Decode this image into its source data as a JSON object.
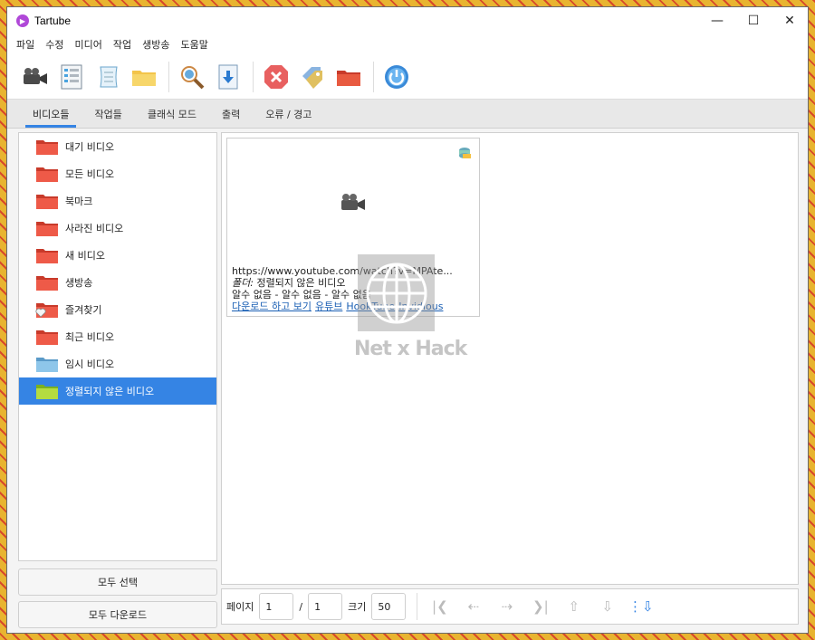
{
  "window": {
    "title": "Tartube"
  },
  "menu": [
    "파일",
    "수정",
    "미디어",
    "작업",
    "생방송",
    "도움말"
  ],
  "tabs": [
    "비디오들",
    "작업들",
    "클래식 모드",
    "출력",
    "오류 / 경고"
  ],
  "folders": [
    {
      "label": "대기 비디오",
      "color": "red"
    },
    {
      "label": "모든 비디오",
      "color": "red"
    },
    {
      "label": "북마크",
      "color": "red"
    },
    {
      "label": "사라진 비디오",
      "color": "red"
    },
    {
      "label": "새 비디오",
      "color": "red"
    },
    {
      "label": "생방송",
      "color": "red"
    },
    {
      "label": "즐겨찾기",
      "color": "red"
    },
    {
      "label": "최근 비디오",
      "color": "red"
    },
    {
      "label": "임시 비디오",
      "color": "blue"
    },
    {
      "label": "정렬되지 않은 비디오",
      "color": "green"
    }
  ],
  "side_buttons": {
    "select_all": "모두 선택",
    "download_all": "모두 다운로드"
  },
  "video_card": {
    "url": "https://www.youtube.com/watch?v=MPAte...",
    "folder_label": "폴더:",
    "folder_value": "정렬되지 않은 비디오",
    "meta": "알수 없음  -  알수 없음  -  알수 없음",
    "links": [
      "다운로드 하고 보기",
      "유튜브",
      "HookTube",
      "Invidious"
    ]
  },
  "pager": {
    "page_label": "페이지",
    "page": "1",
    "separator": "/",
    "total": "1",
    "size_label": "크기",
    "size": "50"
  },
  "watermark": {
    "text": "Net x Hack"
  },
  "colors": {
    "accent": "#3584e4",
    "folder_red": "#e84b3a",
    "folder_blue": "#7fb8e0",
    "folder_green": "#a6d23b"
  }
}
